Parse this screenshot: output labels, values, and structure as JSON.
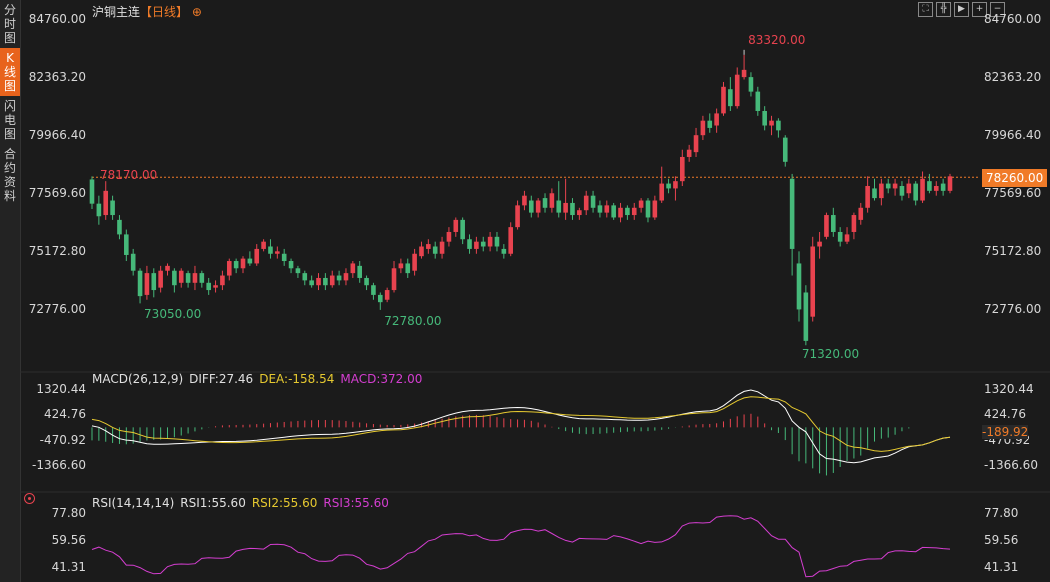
{
  "sidebar": {
    "tabs": [
      {
        "label": "分时图",
        "active": false
      },
      {
        "label": "K线图",
        "active": true
      },
      {
        "label": "闪电图",
        "active": false
      },
      {
        "label": "合约资料",
        "active": false
      }
    ]
  },
  "header": {
    "instrument": "沪铜主连",
    "period": "【日线】",
    "period_icon": "circle-plus-icon"
  },
  "toolbar": {
    "icons": [
      "fullscreen-icon",
      "crosshair-icon",
      "playback-icon",
      "zoom-in-icon",
      "zoom-out-icon"
    ]
  },
  "colors": {
    "up": "#e8434f",
    "down": "#46b97a",
    "diff": "#ffffff",
    "dea": "#e6c930",
    "macd": "#d43ed0",
    "rsi": "#d43ed0",
    "current": "#f07b28"
  },
  "chart_data": [
    {
      "type": "candlestick",
      "title": "沪铜主连",
      "y_ticks": [
        "84760.00",
        "82363.20",
        "79966.40",
        "77569.60",
        "75172.80",
        "72776.00"
      ],
      "ylim": [
        70379.2,
        84760
      ],
      "annotations": {
        "max_label": "83320.00",
        "max_value": 83320,
        "min_label": "71320.00",
        "min_value": 71320,
        "local_low1_label": "73050.00",
        "local_low1_value": 73050,
        "local_low2_label": "72780.00",
        "local_low2_value": 72780,
        "start_label": "78170.00",
        "start_value": 78170,
        "current_label": "78260.00",
        "current_value": 78260
      },
      "candles": [
        [
          78170,
          77170,
          78300,
          76950
        ],
        [
          77170,
          76650,
          77500,
          76300
        ],
        [
          76700,
          77700,
          78100,
          76500
        ],
        [
          77300,
          76700,
          77500,
          76500
        ],
        [
          76500,
          75900,
          76700,
          75700
        ],
        [
          75900,
          75050,
          76100,
          74800
        ],
        [
          75100,
          74400,
          75300,
          74200
        ],
        [
          74400,
          73350,
          74500,
          73050
        ],
        [
          73400,
          74300,
          74600,
          73200
        ],
        [
          74300,
          73600,
          74500,
          73300
        ],
        [
          73700,
          74400,
          74600,
          73500
        ],
        [
          74400,
          74600,
          74700,
          74200
        ],
        [
          74400,
          73800,
          74500,
          73500
        ],
        [
          73900,
          74400,
          74500,
          73700
        ],
        [
          74300,
          73900,
          74400,
          73700
        ],
        [
          73900,
          74300,
          74600,
          73600
        ],
        [
          74300,
          73900,
          74400,
          73700
        ],
        [
          73900,
          73600,
          74100,
          73400
        ],
        [
          73700,
          73800,
          74000,
          73500
        ],
        [
          73800,
          74200,
          74400,
          73600
        ],
        [
          74200,
          74800,
          74900,
          74000
        ],
        [
          74800,
          74500,
          74900,
          74300
        ],
        [
          74500,
          74900,
          75000,
          74300
        ],
        [
          74900,
          74700,
          75200,
          74600
        ],
        [
          74700,
          75300,
          75500,
          74600
        ],
        [
          75300,
          75600,
          75700,
          75200
        ],
        [
          75400,
          75100,
          75700,
          74900
        ],
        [
          75100,
          75200,
          75400,
          74900
        ],
        [
          75100,
          74800,
          75300,
          74600
        ],
        [
          74800,
          74500,
          74900,
          74300
        ],
        [
          74500,
          74300,
          74600,
          74100
        ],
        [
          74300,
          74000,
          74400,
          73800
        ],
        [
          74000,
          73800,
          74200,
          73700
        ],
        [
          73800,
          74100,
          74300,
          73600
        ],
        [
          74100,
          73800,
          74300,
          73600
        ],
        [
          73800,
          74200,
          74400,
          73700
        ],
        [
          74200,
          74000,
          74400,
          73800
        ],
        [
          74000,
          74300,
          74500,
          73800
        ],
        [
          74300,
          74700,
          74800,
          74100
        ],
        [
          74600,
          74100,
          74800,
          73900
        ],
        [
          74100,
          73800,
          74200,
          73600
        ],
        [
          73800,
          73400,
          73900,
          73200
        ],
        [
          73400,
          73100,
          73500,
          72780
        ],
        [
          73200,
          73600,
          73700,
          73100
        ],
        [
          73600,
          74500,
          74800,
          73500
        ],
        [
          74500,
          74700,
          74900,
          74300
        ],
        [
          74700,
          74300,
          74900,
          74100
        ],
        [
          74400,
          75100,
          75300,
          74200
        ],
        [
          75000,
          75400,
          75600,
          74900
        ],
        [
          75300,
          75500,
          75700,
          75100
        ],
        [
          75400,
          75100,
          75600,
          74900
        ],
        [
          75100,
          75600,
          75800,
          74900
        ],
        [
          75600,
          76000,
          76200,
          75400
        ],
        [
          76000,
          76500,
          76600,
          75800
        ],
        [
          76500,
          75700,
          76600,
          75500
        ],
        [
          75700,
          75300,
          75900,
          75100
        ],
        [
          75300,
          75600,
          75800,
          75100
        ],
        [
          75600,
          75400,
          75800,
          75200
        ],
        [
          75400,
          75800,
          76000,
          75200
        ],
        [
          75800,
          75400,
          76000,
          75200
        ],
        [
          75300,
          75100,
          75500,
          74900
        ],
        [
          75100,
          76200,
          76400,
          75000
        ],
        [
          76200,
          77100,
          77300,
          76100
        ],
        [
          77100,
          77500,
          77700,
          76900
        ],
        [
          77300,
          76800,
          77500,
          76600
        ],
        [
          76800,
          77300,
          77400,
          76600
        ],
        [
          77400,
          77000,
          77600,
          76800
        ],
        [
          77000,
          77600,
          77800,
          76800
        ],
        [
          77300,
          76800,
          78100,
          76600
        ],
        [
          76800,
          77200,
          78200,
          76500
        ],
        [
          77200,
          76700,
          77400,
          76500
        ],
        [
          76700,
          76900,
          77000,
          76500
        ],
        [
          76900,
          77500,
          77700,
          76700
        ],
        [
          77500,
          77000,
          77700,
          76800
        ],
        [
          77100,
          76800,
          77300,
          76600
        ],
        [
          76800,
          77100,
          77300,
          76600
        ],
        [
          77100,
          76600,
          77200,
          76500
        ],
        [
          76600,
          77000,
          77200,
          76400
        ],
        [
          77000,
          76700,
          77100,
          76500
        ],
        [
          76700,
          77000,
          77200,
          76500
        ],
        [
          77000,
          77300,
          77400,
          76800
        ],
        [
          77300,
          76600,
          77400,
          76400
        ],
        [
          76600,
          77300,
          77500,
          76500
        ],
        [
          77300,
          78000,
          78700,
          77200
        ],
        [
          78000,
          77800,
          78200,
          77600
        ],
        [
          77800,
          78100,
          78300,
          77300
        ],
        [
          78100,
          79100,
          79400,
          77900
        ],
        [
          79100,
          79400,
          79600,
          78900
        ],
        [
          79300,
          80000,
          80300,
          79100
        ],
        [
          80000,
          80600,
          80800,
          79800
        ],
        [
          80600,
          80300,
          80900,
          80100
        ],
        [
          80400,
          80900,
          81100,
          80100
        ],
        [
          80900,
          82000,
          82200,
          80800
        ],
        [
          81900,
          81200,
          82400,
          81000
        ],
        [
          81200,
          82500,
          82800,
          81100
        ],
        [
          82400,
          82700,
          83320,
          82300
        ],
        [
          82400,
          81800,
          82600,
          81600
        ],
        [
          81800,
          81000,
          82000,
          80800
        ],
        [
          81000,
          80400,
          81200,
          80200
        ],
        [
          80400,
          80600,
          80800,
          80000
        ],
        [
          80600,
          80200,
          80700,
          79900
        ],
        [
          79900,
          78900,
          80000,
          78700
        ],
        [
          78200,
          75300,
          78400,
          74200
        ],
        [
          74700,
          72800,
          75200,
          72300
        ],
        [
          73500,
          71500,
          73800,
          71320
        ],
        [
          72500,
          75400,
          75800,
          72300
        ],
        [
          75400,
          75600,
          76000,
          74900
        ],
        [
          75800,
          76700,
          76800,
          75700
        ],
        [
          76700,
          76000,
          77000,
          75800
        ],
        [
          76000,
          75600,
          76200,
          75400
        ],
        [
          75600,
          75900,
          76200,
          75500
        ],
        [
          76000,
          76700,
          76800,
          75700
        ],
        [
          76500,
          77000,
          77200,
          76300
        ],
        [
          77000,
          77900,
          78300,
          76800
        ],
        [
          77800,
          77400,
          78200,
          77300
        ],
        [
          77400,
          78000,
          78200,
          77100
        ],
        [
          78000,
          77800,
          78200,
          77600
        ],
        [
          77800,
          78000,
          78200,
          77500
        ],
        [
          77900,
          77500,
          78100,
          77300
        ],
        [
          77600,
          78000,
          78200,
          77400
        ],
        [
          78000,
          77300,
          78100,
          77100
        ],
        [
          77300,
          78200,
          78500,
          77200
        ],
        [
          78100,
          77700,
          78400,
          77600
        ],
        [
          77700,
          77900,
          78100,
          77500
        ],
        [
          78000,
          77700,
          78200,
          77500
        ],
        [
          77700,
          78300,
          78400,
          77600
        ]
      ]
    },
    {
      "type": "macd",
      "legend": {
        "name": "MACD(26,12,9)",
        "diff": "DIFF:27.46",
        "dea": "DEA:-158.54",
        "macd": "MACD:372.00"
      },
      "y_ticks": [
        "1320.44",
        "424.76",
        "-470.92",
        "-1366.60"
      ],
      "ylim": [
        -1366.6,
        1320.44
      ],
      "current_label": "-189.92",
      "current_value": -189.92,
      "diff_keypoints": [
        [
          0,
          50
        ],
        [
          5,
          -450
        ],
        [
          9,
          -600
        ],
        [
          20,
          -500
        ],
        [
          34,
          -250
        ],
        [
          44,
          -50
        ],
        [
          56,
          600
        ],
        [
          62,
          700
        ],
        [
          72,
          300
        ],
        [
          80,
          250
        ],
        [
          90,
          580
        ],
        [
          96,
          1320
        ],
        [
          100,
          900
        ],
        [
          103,
          0
        ],
        [
          107,
          -1100
        ],
        [
          111,
          -1250
        ],
        [
          115,
          -1050
        ],
        [
          120,
          -650
        ],
        [
          125,
          -350
        ],
        [
          128,
          -100
        ]
      ],
      "dea_keypoints": [
        [
          0,
          280
        ],
        [
          5,
          -150
        ],
        [
          9,
          -380
        ],
        [
          20,
          -540
        ],
        [
          34,
          -380
        ],
        [
          44,
          -90
        ],
        [
          56,
          380
        ],
        [
          62,
          560
        ],
        [
          72,
          420
        ],
        [
          80,
          320
        ],
        [
          90,
          520
        ],
        [
          96,
          1080
        ],
        [
          100,
          1000
        ],
        [
          103,
          600
        ],
        [
          107,
          -250
        ],
        [
          111,
          -700
        ],
        [
          115,
          -850
        ],
        [
          120,
          -650
        ],
        [
          125,
          -350
        ],
        [
          128,
          -158
        ]
      ]
    },
    {
      "type": "line",
      "legend": {
        "name": "RSI(14,14,14)",
        "rsi1": "RSI1:55.60",
        "rsi2": "RSI2:55.60",
        "rsi3": "RSI3:55.60"
      },
      "y_ticks": [
        "77.80",
        "59.56",
        "41.31"
      ],
      "ylim": [
        38,
        79
      ],
      "series": [
        {
          "name": "RSI1",
          "keypoints": [
            [
              0,
              55
            ],
            [
              3,
              52
            ],
            [
              6,
              42
            ],
            [
              9,
              38
            ],
            [
              13,
              44
            ],
            [
              18,
              48
            ],
            [
              24,
              55
            ],
            [
              28,
              57
            ],
            [
              33,
              46
            ],
            [
              38,
              50
            ],
            [
              42,
              40
            ],
            [
              46,
              50
            ],
            [
              50,
              62
            ],
            [
              54,
              65
            ],
            [
              58,
              60
            ],
            [
              64,
              68
            ],
            [
              70,
              60
            ],
            [
              76,
              62
            ],
            [
              82,
              58
            ],
            [
              88,
              72
            ],
            [
              94,
              77
            ],
            [
              96,
              74
            ],
            [
              100,
              62
            ],
            [
              103,
              52
            ],
            [
              104,
              36
            ],
            [
              106,
              38
            ],
            [
              110,
              44
            ],
            [
              114,
              48
            ],
            [
              118,
              53
            ],
            [
              124,
              55
            ],
            [
              128,
              57
            ]
          ]
        }
      ]
    }
  ]
}
